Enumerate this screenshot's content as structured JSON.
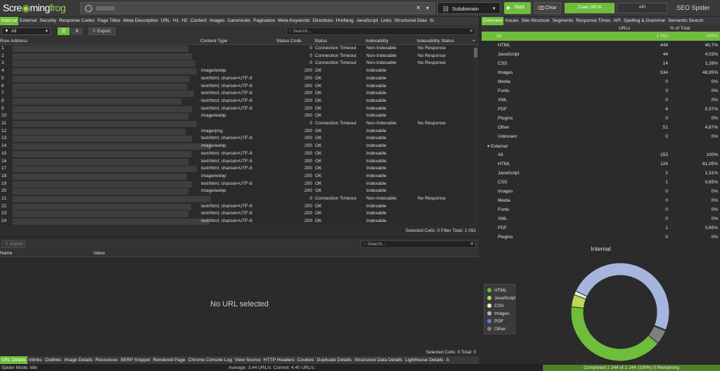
{
  "app": {
    "logo_left": "Scre",
    "logo_mid": "ming",
    "logo_right": "frog",
    "brand": "SEO Spider",
    "brand_accent": "#a0d44a"
  },
  "toolbar": {
    "mode": "Subdomain",
    "start": "Start",
    "clear": "Clear",
    "progress": "Crawl 100 %",
    "api": "API"
  },
  "main_tabs": [
    "Internal",
    "External",
    "Security",
    "Response Codes",
    "Page Titles",
    "Meta Description",
    "URL",
    "H1",
    "H2",
    "Content",
    "Images",
    "Canonicals",
    "Pagination",
    "Meta Keywords",
    "Directives",
    "Hreflang",
    "JavaScript",
    "Links",
    "Structured Data",
    "Si"
  ],
  "right_tabs": [
    "Overview",
    "Issues",
    "Site Structure",
    "Segments",
    "Response Times",
    "API",
    "Spelling & Grammar",
    "Semantic Search"
  ],
  "filter": {
    "value": "All",
    "export": "Export",
    "search_placeholder": "Search..."
  },
  "grid": {
    "columns": [
      "Row",
      "Address",
      "Content Type",
      "Status Code",
      "Status",
      "Indexability",
      "Indexability Status"
    ],
    "rows": [
      {
        "n": "1",
        "ct": "",
        "sc": "0",
        "st": "Connection Timeout",
        "ix": "Non-Indexable",
        "is": "No Response"
      },
      {
        "n": "2",
        "ct": "",
        "sc": "0",
        "st": "Connection Timeout",
        "ix": "Non-Indexable",
        "is": "No Response"
      },
      {
        "n": "3",
        "ct": "",
        "sc": "0",
        "st": "Connection Timeout",
        "ix": "Non-Indexable",
        "is": "No Response"
      },
      {
        "n": "4",
        "ct": "image/webp",
        "sc": "200",
        "st": "OK",
        "ix": "Indexable",
        "is": ""
      },
      {
        "n": "5",
        "ct": "text/html; charset=UTF-8",
        "sc": "200",
        "st": "OK",
        "ix": "Indexable",
        "is": ""
      },
      {
        "n": "6",
        "ct": "text/html; charset=UTF-8",
        "sc": "200",
        "st": "OK",
        "ix": "Indexable",
        "is": ""
      },
      {
        "n": "7",
        "ct": "text/html; charset=UTF-8",
        "sc": "200",
        "st": "OK",
        "ix": "Indexable",
        "is": ""
      },
      {
        "n": "8",
        "ct": "text/html; charset=UTF-8",
        "sc": "200",
        "st": "OK",
        "ix": "Indexable",
        "is": ""
      },
      {
        "n": "9",
        "ct": "text/html; charset=UTF-8",
        "sc": "200",
        "st": "OK",
        "ix": "Indexable",
        "is": ""
      },
      {
        "n": "10",
        "ct": "image/webp",
        "sc": "200",
        "st": "OK",
        "ix": "Indexable",
        "is": ""
      },
      {
        "n": "11",
        "ct": "",
        "sc": "0",
        "st": "Connection Timeout",
        "ix": "Non-Indexable",
        "is": "No Response"
      },
      {
        "n": "12",
        "ct": "image/png",
        "sc": "200",
        "st": "OK",
        "ix": "Indexable",
        "is": ""
      },
      {
        "n": "13",
        "ct": "text/html; charset=UTF-8",
        "sc": "200",
        "st": "OK",
        "ix": "Indexable",
        "is": ""
      },
      {
        "n": "14",
        "ct": "image/webp",
        "sc": "200",
        "st": "OK",
        "ix": "Indexable",
        "is": ""
      },
      {
        "n": "15",
        "ct": "text/html; charset=UTF-8",
        "sc": "200",
        "st": "OK",
        "ix": "Indexable",
        "is": ""
      },
      {
        "n": "16",
        "ct": "text/html; charset=UTF-8",
        "sc": "200",
        "st": "OK",
        "ix": "Indexable",
        "is": ""
      },
      {
        "n": "17",
        "ct": "text/html; charset=UTF-8",
        "sc": "200",
        "st": "OK",
        "ix": "Indexable",
        "is": ""
      },
      {
        "n": "18",
        "ct": "image/webp",
        "sc": "200",
        "st": "OK",
        "ix": "Indexable",
        "is": ""
      },
      {
        "n": "19",
        "ct": "text/html; charset=UTF-8",
        "sc": "200",
        "st": "OK",
        "ix": "Indexable",
        "is": ""
      },
      {
        "n": "20",
        "ct": "image/webp",
        "sc": "200",
        "st": "OK",
        "ix": "Indexable",
        "is": ""
      },
      {
        "n": "21",
        "ct": "",
        "sc": "0",
        "st": "Connection Timeout",
        "ix": "Non-Indexable",
        "is": "No Response"
      },
      {
        "n": "22",
        "ct": "text/html; charset=UTF-8",
        "sc": "200",
        "st": "OK",
        "ix": "Indexable",
        "is": ""
      },
      {
        "n": "23",
        "ct": "text/html; charset=UTF-8",
        "sc": "200",
        "st": "OK",
        "ix": "Indexable",
        "is": ""
      },
      {
        "n": "24",
        "ct": "text/html; charset=UTF-8",
        "sc": "200",
        "st": "OK",
        "ix": "Indexable",
        "is": ""
      }
    ],
    "status": "Selected Cells:  0  Filter Total:  1 091"
  },
  "lower": {
    "export": "Export",
    "search_placeholder": "Search...",
    "col_name": "Name",
    "col_value": "Value",
    "empty": "No URL selected",
    "status": "Selected Cells:  0  Total:  0"
  },
  "bottom_tabs": [
    "URL Details",
    "Inlinks",
    "Outlinks",
    "Image Details",
    "Resources",
    "SERP Snippet",
    "Rendered Page",
    "Chrome Console Log",
    "View Source",
    "HTTP Headers",
    "Cookies",
    "Duplicate Details",
    "Structured Data Details",
    "Lighthouse Details",
    "A"
  ],
  "footer": {
    "mode": "Spider Mode: Idle",
    "speed": "Average: 3.44 URL/s. Current: 4.40 URL/s.",
    "completed": "Completed 1 244 of 1 244 (100%) 0 Remaining"
  },
  "overview": {
    "col_urls": "URLs",
    "col_pct": "% of Total",
    "rows": [
      {
        "label": "All",
        "urls": "1 091",
        "pct": "100%",
        "indent": 0,
        "sel": true
      },
      {
        "label": "HTML",
        "urls": "444",
        "pct": "40,7%",
        "indent": 1
      },
      {
        "label": "JavaScript",
        "urls": "44",
        "pct": "4,03%",
        "indent": 1
      },
      {
        "label": "CSS",
        "urls": "14",
        "pct": "1,28%",
        "indent": 1
      },
      {
        "label": "Images",
        "urls": "534",
        "pct": "48,95%",
        "indent": 1
      },
      {
        "label": "Media",
        "urls": "0",
        "pct": "0%",
        "indent": 1
      },
      {
        "label": "Fonts",
        "urls": "0",
        "pct": "0%",
        "indent": 1
      },
      {
        "label": "XML",
        "urls": "0",
        "pct": "0%",
        "indent": 1
      },
      {
        "label": "PDF",
        "urls": "4",
        "pct": "0,37%",
        "indent": 1
      },
      {
        "label": "Plugins",
        "urls": "0",
        "pct": "0%",
        "indent": 1
      },
      {
        "label": "Other",
        "urls": "51",
        "pct": "4,67%",
        "indent": 1
      },
      {
        "label": "Unknown",
        "urls": "0",
        "pct": "0%",
        "indent": 1
      },
      {
        "label": "▾ External",
        "urls": "",
        "pct": "",
        "indent": 0
      },
      {
        "label": "All",
        "urls": "153",
        "pct": "100%",
        "indent": 1
      },
      {
        "label": "HTML",
        "urls": "124",
        "pct": "81,05%",
        "indent": 1
      },
      {
        "label": "JavaScript",
        "urls": "2",
        "pct": "1,31%",
        "indent": 1
      },
      {
        "label": "CSS",
        "urls": "1",
        "pct": "0,65%",
        "indent": 1
      },
      {
        "label": "Images",
        "urls": "0",
        "pct": "0%",
        "indent": 1
      },
      {
        "label": "Media",
        "urls": "0",
        "pct": "0%",
        "indent": 1
      },
      {
        "label": "Fonts",
        "urls": "0",
        "pct": "0%",
        "indent": 1
      },
      {
        "label": "XML",
        "urls": "0",
        "pct": "0%",
        "indent": 1
      },
      {
        "label": "PDF",
        "urls": "1",
        "pct": "0,65%",
        "indent": 1
      },
      {
        "label": "Plugins",
        "urls": "0",
        "pct": "0%",
        "indent": 1
      }
    ]
  },
  "chart_data": {
    "type": "pie",
    "title": "Internal",
    "categories": [
      "HTML",
      "JavaScript",
      "CSS",
      "Images",
      "PDF",
      "Other"
    ],
    "values": [
      444,
      44,
      14,
      534,
      4,
      51
    ],
    "colors": [
      "#6fbd3c",
      "#b7d957",
      "#e9f0d4",
      "#a6b5dc",
      "#5a7fd6",
      "#808080"
    ],
    "legend": "left"
  }
}
